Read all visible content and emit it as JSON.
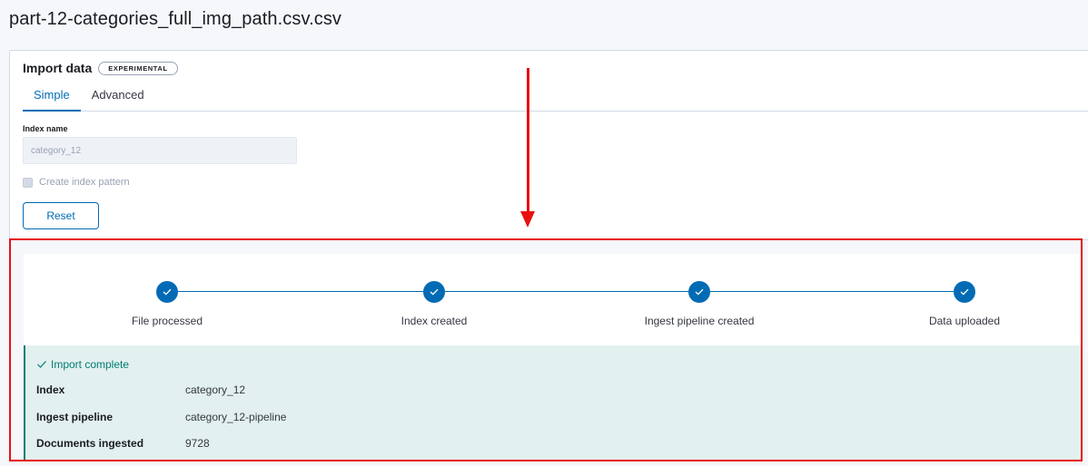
{
  "page": {
    "file_title": "part-12-categories_full_img_path.csv.csv"
  },
  "import_panel": {
    "title": "Import data",
    "badge": "EXPERIMENTAL",
    "tabs": [
      {
        "label": "Simple",
        "active": true
      },
      {
        "label": "Advanced",
        "active": false
      }
    ],
    "index_name_label": "Index name",
    "index_name_value": "category_12",
    "create_index_pattern_label": "Create index pattern",
    "create_index_pattern_checked": false,
    "reset_label": "Reset"
  },
  "progress": {
    "steps": [
      {
        "label": "File processed",
        "done": true
      },
      {
        "label": "Index created",
        "done": true
      },
      {
        "label": "Ingest pipeline created",
        "done": true
      },
      {
        "label": "Data uploaded",
        "done": true
      }
    ]
  },
  "result": {
    "title": "Import complete",
    "rows": [
      {
        "key": "Index",
        "value": "category_12"
      },
      {
        "key": "Ingest pipeline",
        "value": "category_12-pipeline"
      },
      {
        "key": "Documents ingested",
        "value": "9728"
      }
    ]
  },
  "colors": {
    "accent": "#006bb4",
    "success": "#017d73",
    "annotation": "#e8110f"
  },
  "icons": {
    "step_icon": "check-icon",
    "complete_icon": "check-icon"
  }
}
